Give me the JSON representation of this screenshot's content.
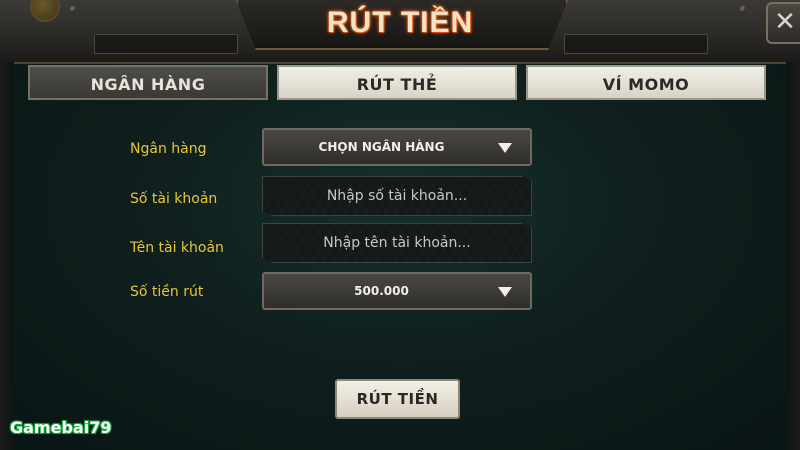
{
  "header": {
    "title": "RÚT TIỀN"
  },
  "tabs": [
    {
      "label": "NGÂN HÀNG",
      "active": true
    },
    {
      "label": "RÚT THẺ",
      "active": false
    },
    {
      "label": "VÍ MOMO",
      "active": false
    }
  ],
  "form": {
    "bank": {
      "label": "Ngân hàng",
      "value": "CHỌN NGÂN HÀNG"
    },
    "account_number": {
      "label": "Số tài khoản",
      "placeholder": "Nhập số tài khoản..."
    },
    "account_name": {
      "label": "Tên tài khoản",
      "placeholder": "Nhập tên tài khoản..."
    },
    "amount": {
      "label": "Số tiền rút",
      "value": "500.000"
    },
    "submit_label": "RÚT TIỀN"
  },
  "brand": "Gamebai79",
  "icons": {
    "close": "close-icon",
    "dropdown": "triangle-down-icon"
  },
  "colors": {
    "label": "#e8c637",
    "title_glow": "#ff5a10",
    "brand_outline": "#18a43c"
  }
}
